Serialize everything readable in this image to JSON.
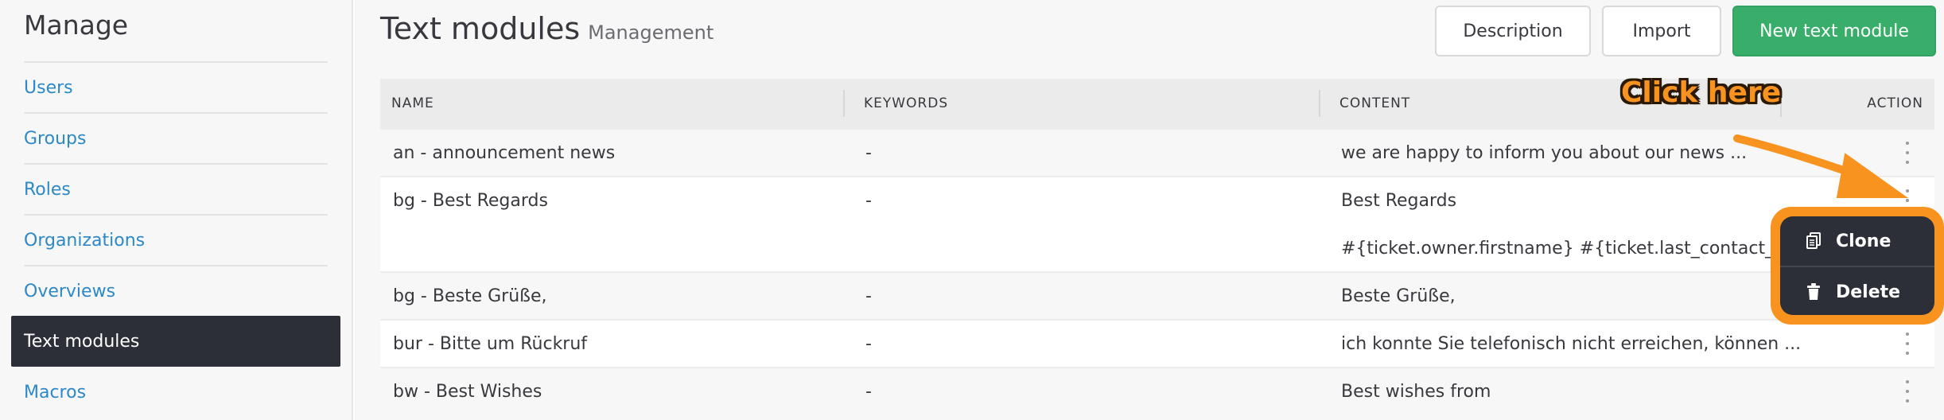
{
  "sidebar": {
    "title": "Manage",
    "items": [
      {
        "label": "Users"
      },
      {
        "label": "Groups"
      },
      {
        "label": "Roles"
      },
      {
        "label": "Organizations"
      },
      {
        "label": "Overviews"
      },
      {
        "label": "Text modules"
      },
      {
        "label": "Macros"
      }
    ]
  },
  "header": {
    "title": "Text modules",
    "subtitle": "Management",
    "description_label": "Description",
    "import_label": "Import",
    "new_label": "New text module"
  },
  "table": {
    "columns": [
      "NAME",
      "KEYWORDS",
      "CONTENT",
      "ACTION"
    ],
    "rows": [
      {
        "name": "an - announcement news",
        "keywords": "-",
        "content": "we are happy to inform you about our news ...",
        "content2": ""
      },
      {
        "name": "bg - Best Regards",
        "keywords": "-",
        "content": "Best Regards",
        "content2": "#{ticket.owner.firstname} #{ticket.last_contact_agent_"
      },
      {
        "name": "bg - Beste Grüße,",
        "keywords": "-",
        "content": "Beste Grüße,",
        "content2": ""
      },
      {
        "name": "bur - Bitte um Rückruf",
        "keywords": "-",
        "content": "ich konnte Sie telefonisch nicht erreichen, können ...",
        "content2": ""
      },
      {
        "name": "bw - Best Wishes",
        "keywords": "-",
        "content": "Best wishes from",
        "content2": ""
      }
    ]
  },
  "popup": {
    "clone_label": "Clone",
    "delete_label": "Delete"
  },
  "annotation": {
    "text": "Click here",
    "color": "#f7931e"
  },
  "colors": {
    "accent_link": "#2c88c6",
    "primary_button": "#38ae6a",
    "active_nav": "#2d2f38"
  }
}
